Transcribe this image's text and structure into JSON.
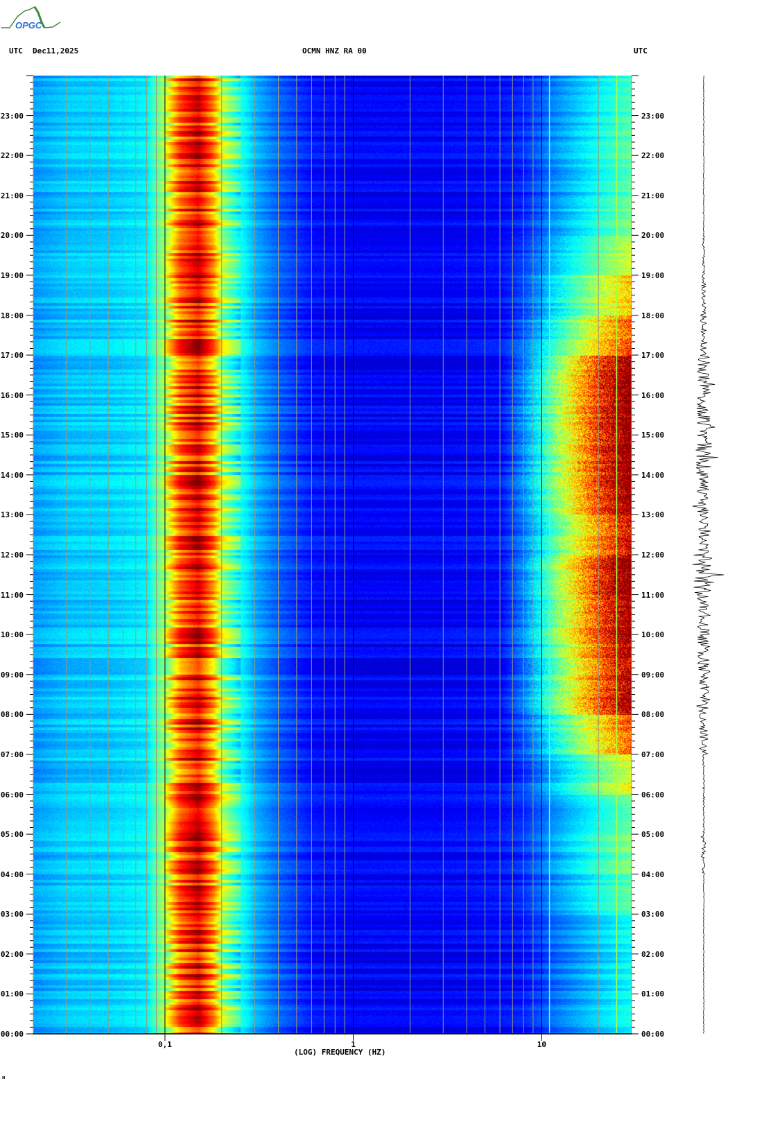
{
  "header": {
    "left_tz": "UTC",
    "date": "Dec11,2025",
    "station": "OCMN HNZ RA 00",
    "right_tz": "UTC"
  },
  "logo": {
    "text": "OPGC"
  },
  "footer_mark": "ᴎ",
  "chart_data": {
    "type": "heatmap",
    "title": "OCMN HNZ RA 00",
    "xlabel": "(LOG) FREQUENCY (HZ)",
    "ylabel": "UTC",
    "xscale": "log",
    "xlim": [
      0.02,
      30
    ],
    "ylim_hours": [
      0,
      24
    ],
    "xticks": [
      {
        "value": 0.1,
        "label": "0,1"
      },
      {
        "value": 1,
        "label": "1"
      },
      {
        "value": 10,
        "label": "10"
      }
    ],
    "yticks": [
      "00:00",
      "01:00",
      "02:00",
      "03:00",
      "04:00",
      "05:00",
      "06:00",
      "07:00",
      "08:00",
      "09:00",
      "10:00",
      "11:00",
      "12:00",
      "13:00",
      "14:00",
      "15:00",
      "16:00",
      "17:00",
      "18:00",
      "19:00",
      "20:00",
      "21:00",
      "22:00",
      "23:00"
    ],
    "colormap": "jet",
    "frequency_profile": {
      "freq_hz": [
        0.02,
        0.03,
        0.05,
        0.08,
        0.1,
        0.12,
        0.15,
        0.18,
        0.2,
        0.25,
        0.3,
        0.4,
        0.6,
        1,
        3,
        8,
        12,
        20,
        30
      ],
      "intensity": [
        0.28,
        0.32,
        0.33,
        0.36,
        0.55,
        0.78,
        0.9,
        0.72,
        0.55,
        0.4,
        0.3,
        0.22,
        0.14,
        0.12,
        0.12,
        0.14,
        0.22,
        0.3,
        0.35
      ]
    },
    "high_freq_activity_by_hour": [
      0.05,
      0.05,
      0.05,
      0.15,
      0.2,
      0.15,
      0.35,
      0.6,
      0.85,
      0.85,
      0.9,
      0.95,
      0.75,
      0.9,
      0.95,
      0.95,
      0.95,
      0.6,
      0.45,
      0.3,
      0.2,
      0.15,
      0.15,
      0.12
    ],
    "trace_envelope_by_hour": [
      0.02,
      0.02,
      0.02,
      0.02,
      0.08,
      0.04,
      0.05,
      0.2,
      0.35,
      0.3,
      0.3,
      0.55,
      0.25,
      0.35,
      0.4,
      0.35,
      0.3,
      0.15,
      0.1,
      0.05,
      0.02,
      0.02,
      0.02,
      0.02
    ]
  }
}
